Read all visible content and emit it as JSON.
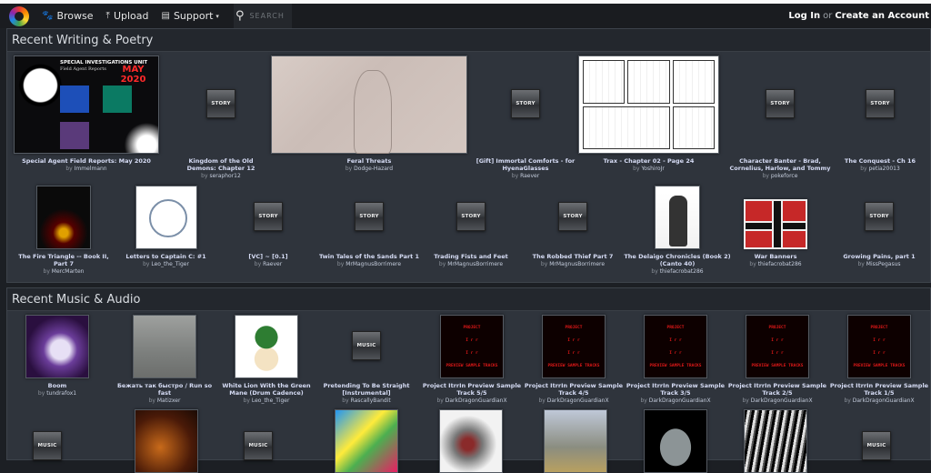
{
  "nav": {
    "browse": "Browse",
    "upload": "Upload",
    "support": "Support",
    "search_placeholder": "SEARCH",
    "login": "Log In",
    "or": "or",
    "create_account": "Create an Account"
  },
  "sections": [
    {
      "title": "Recent Writing & Poetry",
      "rows": [
        [
          {
            "title": "Special Agent Field Reports: May 2020",
            "author": "Immelmann",
            "thumb": "image"
          },
          {
            "title": "Kingdom of the Old Demons: Chapter 12",
            "author": "seraphor12",
            "thumb": "STORY"
          },
          {
            "title": "Feral Threats",
            "author": "Dodge-Hazard",
            "thumb": "image"
          },
          {
            "title": "[Gift] Immortal Comforts - for HyenaGlasses",
            "author": "Raever",
            "thumb": "STORY"
          },
          {
            "title": "Trax - Chapter 02 - Page 24",
            "author": "YoshiroJr",
            "thumb": "image"
          },
          {
            "title": "Character Banter - Brad, Cornelius, Harlow, and Tommy",
            "author": "pokeforce",
            "thumb": "STORY"
          },
          {
            "title": "The Conquest - Ch 16",
            "author": "petia20013",
            "thumb": "STORY"
          }
        ],
        [
          {
            "title": "The Fire Triangle -- Book II, Part 7",
            "author": "MercMarten",
            "thumb": "image"
          },
          {
            "title": "Letters to Captain C: #1",
            "author": "Leo_the_Tiger",
            "thumb": "image"
          },
          {
            "title": "[VC] ~ [0.1]",
            "author": "Raever",
            "thumb": "STORY"
          },
          {
            "title": "Twin Tales of the Sands Part 1",
            "author": "MrMagnusBorrimere",
            "thumb": "STORY"
          },
          {
            "title": "Trading Fists and Feet",
            "author": "MrMagnusBorrimere",
            "thumb": "STORY"
          },
          {
            "title": "The Robbed Thief Part 7",
            "author": "MrMagnusBorrimere",
            "thumb": "STORY"
          },
          {
            "title": "The Delaigo Chronicles (Book 2) (Canto 40)",
            "author": "thiefacrobat286",
            "thumb": "image"
          },
          {
            "title": "War Banners",
            "author": "thiefacrobat286",
            "thumb": "image"
          },
          {
            "title": "Growing Pains, part 1",
            "author": "MissPegasus",
            "thumb": "STORY"
          }
        ]
      ]
    },
    {
      "title": "Recent Music & Audio",
      "rows": [
        [
          {
            "title": "Boom",
            "author": "tundrafox1",
            "thumb": "image"
          },
          {
            "title": "Бежать так быстро / Run so fast",
            "author": "Matizxer",
            "thumb": "image"
          },
          {
            "title": "White Lion With the Green Mane (Drum Cadence)",
            "author": "Leo_the_Tiger",
            "thumb": "image"
          },
          {
            "title": "Pretending To Be Straight [Instrumental]",
            "author": "RascallyBandit",
            "thumb": "MUSIC"
          },
          {
            "title": "Project ItrrIn Preview Sample Track 5/5",
            "author": "DarkDragonGuardianX",
            "thumb": "image"
          },
          {
            "title": "Project ItrrIn Preview Sample Track 4/5",
            "author": "DarkDragonGuardianX",
            "thumb": "image"
          },
          {
            "title": "Project ItrrIn Preview Sample Track 3/5",
            "author": "DarkDragonGuardianX",
            "thumb": "image"
          },
          {
            "title": "Project ItrrIn Preview Sample Track 2/5",
            "author": "DarkDragonGuardianX",
            "thumb": "image"
          },
          {
            "title": "Project ItrrIn Preview Sample Track 1/5",
            "author": "DarkDragonGuardianX",
            "thumb": "image"
          }
        ]
      ]
    }
  ],
  "thumb_text": {
    "sp_line1": "SPECIAL INVESTIGATIONS UNIT",
    "sp_line2": "Field Agent Reports",
    "sp_month": "MAY 2020",
    "itrr_line1": "PROJECT",
    "itrr_line2": "I  r r",
    "itrr_line3": "PREVIEW SAMPLE TRACKS",
    "music_label": "MUSIC",
    "story_label": "STORY"
  },
  "by_label": "by"
}
